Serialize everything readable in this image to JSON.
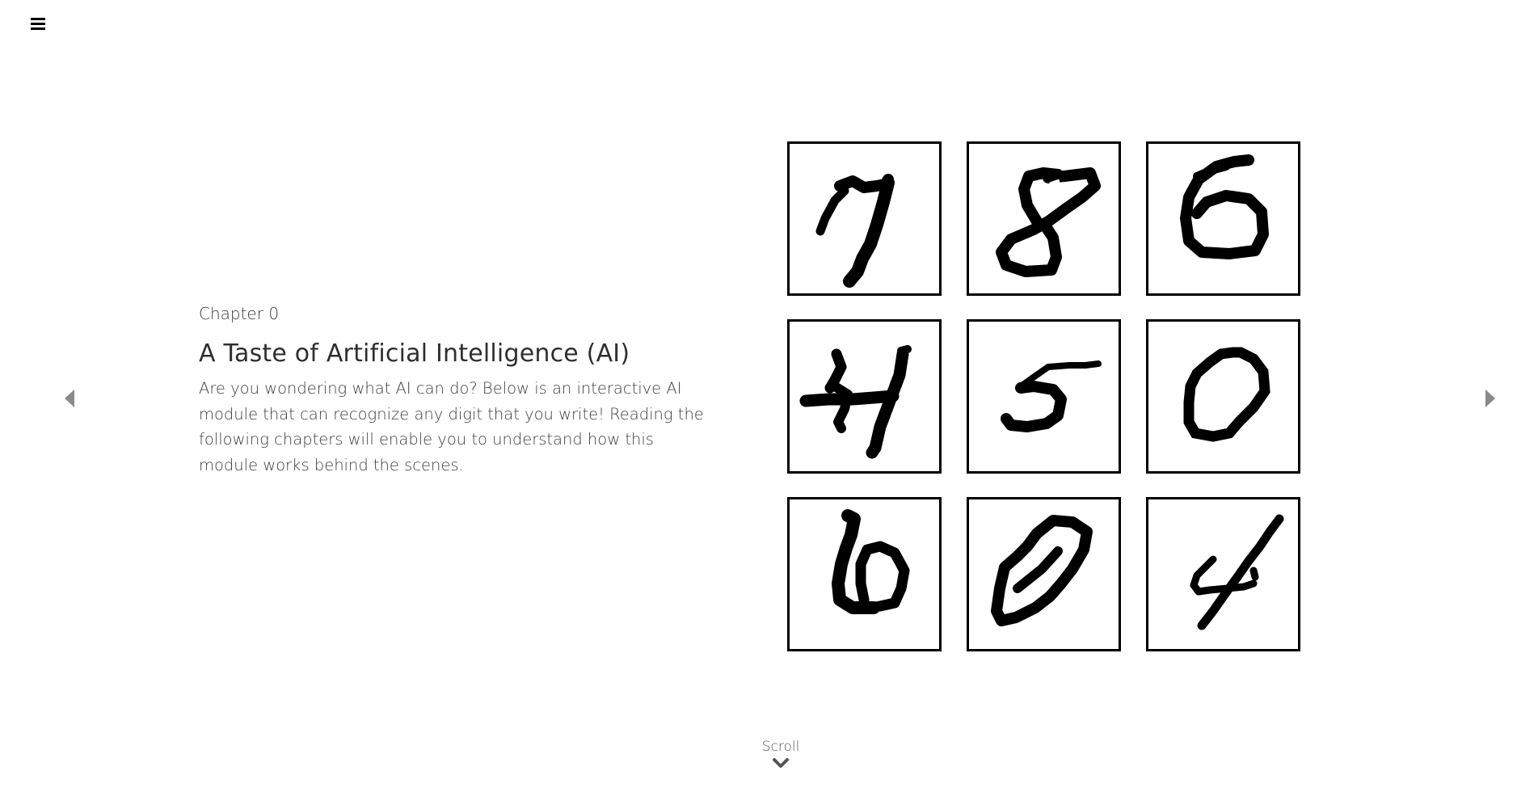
{
  "header": {
    "menu_icon": "hamburger-icon"
  },
  "navigation": {
    "prev_icon": "caret-left-icon",
    "next_icon": "caret-right-icon",
    "arrow_color": "#8a8a8a"
  },
  "intro": {
    "chapter_label": "Chapter 0",
    "title": "A Taste of Artificial Intelligence (AI)",
    "description": "Are you wondering what AI can do? Below is an interactive AI module that can recognize any digit that you write! Reading the following chapters will enable you to understand how this module works behind the scenes."
  },
  "digit_samples": {
    "digits": [
      "7",
      "8",
      "6",
      "4",
      "5",
      "0",
      "6",
      "0",
      "4"
    ],
    "border_color": "#000000",
    "stroke_color": "#000000"
  },
  "scroll": {
    "label": "Scroll",
    "icon": "chevron-down-icon",
    "color": "#555555"
  }
}
